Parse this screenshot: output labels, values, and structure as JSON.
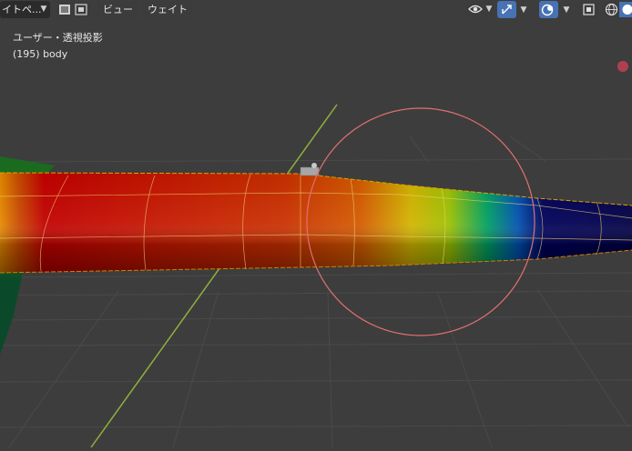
{
  "header": {
    "mode_dropdown": "イトペ...",
    "menu_view": "ビュー",
    "menu_weight": "ウェイト"
  },
  "overlay": {
    "view_name": "ユーザー・透視投影",
    "object_info": "(195) body"
  },
  "icons": {
    "mode": "mode-select-icons",
    "visibility": "eye-icon",
    "gizmo": "gizmo-icon",
    "overlays": "overlays-icon",
    "xray": "xray-icon",
    "shading": "shading-icons"
  },
  "colors": {
    "viewport_bg": "#3d3d3d",
    "brush_circle": "#e07070",
    "x_axis": "#9bbf45",
    "weight_hot": "#c80000",
    "weight_cold": "#00004d"
  }
}
